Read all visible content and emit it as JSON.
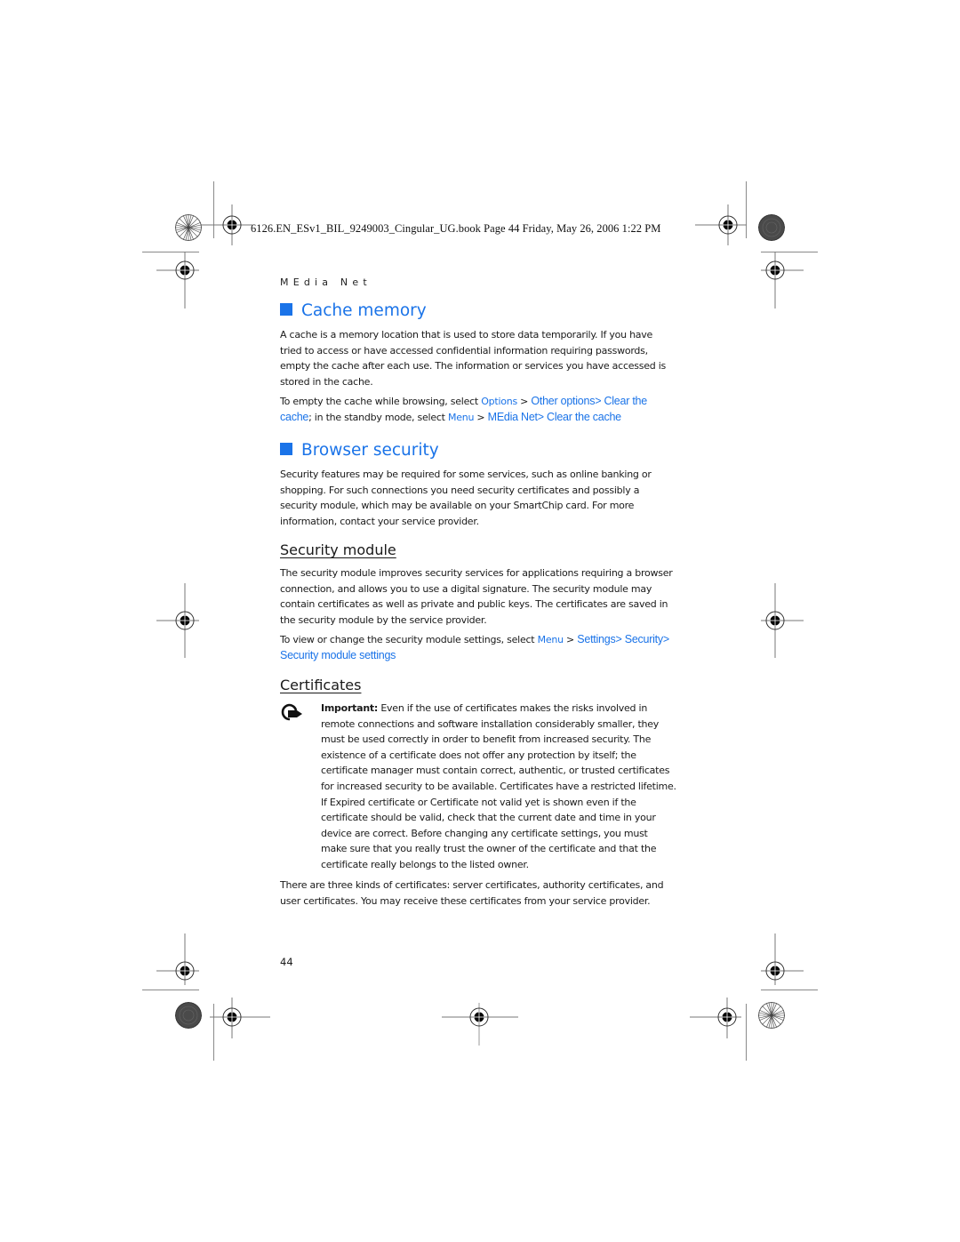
{
  "slug": "6126.EN_ESv1_BIL_9249003_Cingular_UG.book  Page 44  Friday, May 26, 2006  1:22 PM",
  "running_head": "MEdia Net",
  "page_number": "44",
  "accent_color": "#1a73e8",
  "sections": {
    "cache": {
      "title": "Cache memory",
      "para1": "A cache is a memory location that is used to store data temporarily. If you have tried to access or have accessed confidential information requiring passwords, empty the cache after each use. The information or services you have accessed is stored in the cache.",
      "para2_pre": "To empty the cache while browsing, select ",
      "para2_menu1": "Options",
      "sep": " > ",
      "para2_menu2": "Other options",
      "sep2": "> ",
      "para2_menu3": "Clear the cache",
      "para2_mid": "; in the standby mode, select ",
      "para2_menu4": "Menu",
      "para2_menu5": "MEdia Net",
      "para2_menu6": "Clear the cache"
    },
    "browser_security": {
      "title": "Browser security",
      "para1": "Security features may be required for some services, such as online banking or shopping. For such connections you need security certificates and possibly a security module, which may be available on your SmartChip card. For more information, contact your service provider."
    },
    "security_module": {
      "title": "Security module",
      "para1": "The security module improves security services for applications requiring a browser connection, and allows you to use a digital signature. The security module may contain certificates as well as private and public keys. The certificates are saved in the security module by the service provider.",
      "para2_pre": "To view or change the security module settings, select ",
      "menu1": "Menu",
      "sep": " > ",
      "menu2": "Settings",
      "sep2": "> ",
      "menu3": "Security",
      "sep3": ">",
      "menu4": "Security module settings"
    },
    "certificates": {
      "title": "Certificates",
      "note_label": "Important:",
      "note_text": " Even if the use of certificates makes the risks involved in remote connections and software installation considerably smaller, they must be used correctly in order to benefit from increased security. The existence of a certificate does not offer any protection by itself; the certificate manager must contain correct, authentic, or trusted certificates for increased security to be available. Certificates have a restricted lifetime. If Expired certificate or Certificate not valid yet is shown even if the certificate should be valid, check that the current date and time in your device are correct. Before changing any certificate settings, you must make sure that you really trust the owner of the certificate and that the certificate really belongs to the listed owner.",
      "para1": "There are three kinds of certificates: server certificates, authority certificates, and user certificates. You may receive these certificates from your service provider."
    }
  },
  "icons": {
    "note": "important-note-icon",
    "registration": "registration-mark-icon",
    "color_bar": "star-target-icon"
  }
}
